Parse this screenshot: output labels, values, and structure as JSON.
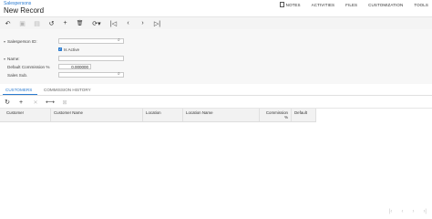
{
  "header": {
    "breadcrumb": "Salespersons",
    "title": "New Record",
    "actions": [
      {
        "label": "NOTES",
        "icon": "document-icon"
      },
      {
        "label": "ACTIVITIES"
      },
      {
        "label": "FILES"
      },
      {
        "label": "CUSTOMIZATION"
      },
      {
        "label": "TOOLS"
      }
    ]
  },
  "toolbar": {
    "icons": [
      "back-icon",
      "save-icon",
      "save-close-icon",
      "undo-icon",
      "add-icon",
      "delete-icon",
      "copy-paste-icon",
      "first-record-icon",
      "previous-record-icon",
      "next-record-icon",
      "last-record-icon"
    ],
    "glyphs": {
      "back": "↶",
      "save": "▣",
      "save_close": "▤",
      "undo": "↺",
      "add": "+",
      "delete": "🗑",
      "copy_paste": "⟳▾",
      "first": "|◁",
      "prev": "‹",
      "next": "›",
      "last": "▷|"
    }
  },
  "form": {
    "collapse_glyph": "▾",
    "salesperson_id": {
      "label": "Salesperson ID:",
      "value": ""
    },
    "is_active": {
      "label": "Is Active",
      "checked": true,
      "check_glyph": "✓"
    },
    "name": {
      "label": "Name:",
      "value": ""
    },
    "default_commission": {
      "label": "Default Commission %",
      "value": "0.000000"
    },
    "sales_sub": {
      "label": "Sales Sub.",
      "value": ""
    },
    "lookup_glyph": "⌕"
  },
  "tabs": [
    {
      "label": "CUSTOMERS",
      "active": true
    },
    {
      "label": "COMMISSION HISTORY",
      "active": false
    }
  ],
  "grid_toolbar": {
    "glyphs": {
      "refresh": "↻",
      "add": "+",
      "delete": "✕",
      "fit": "⟷",
      "export": "⊠"
    }
  },
  "grid": {
    "columns": [
      "Customer",
      "Customer Name",
      "Location",
      "Location Name",
      "Commission %",
      "Default"
    ],
    "rows": []
  },
  "pager": {
    "glyphs": [
      "|‹",
      "‹",
      "›",
      "›|"
    ]
  }
}
